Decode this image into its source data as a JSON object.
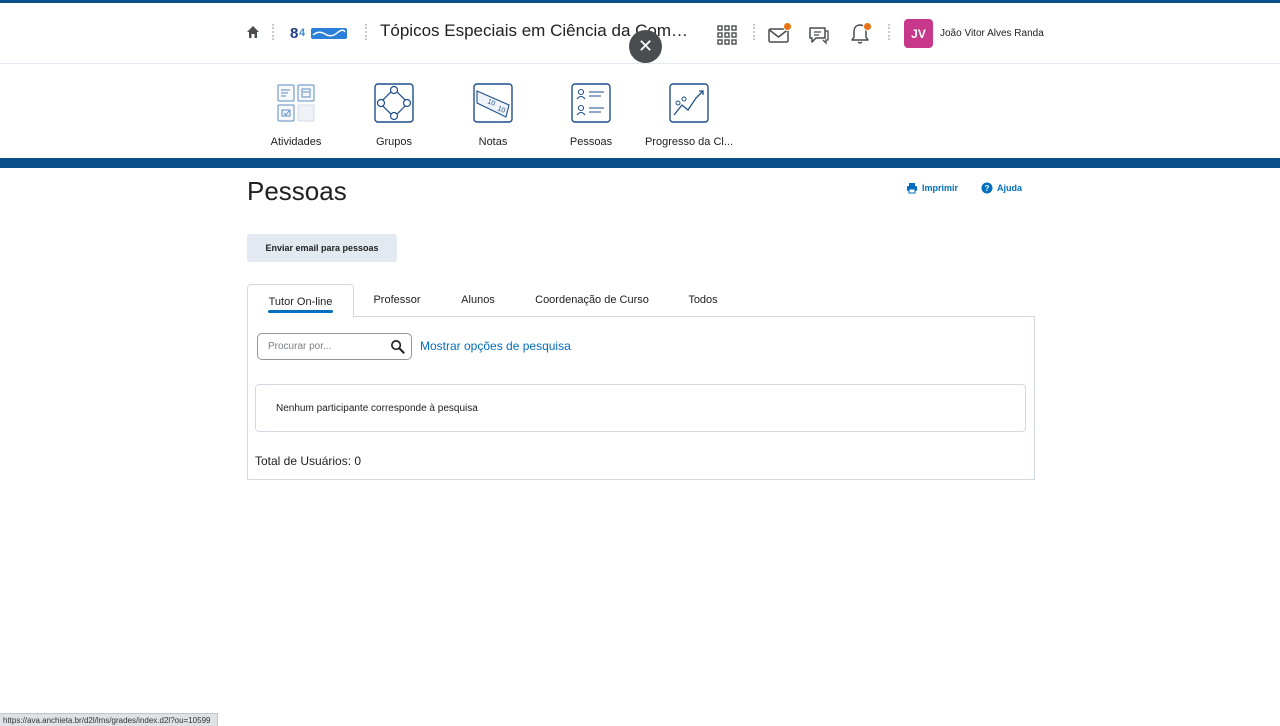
{
  "header": {
    "course_title": "Tópicos Especiais em Ciência da Compu...",
    "close_glyph": "✕",
    "user": {
      "initials": "JV",
      "name": "João Vitor Alves Randa",
      "avatar_color": "#c7388a"
    },
    "notification_color": "#e87511"
  },
  "nav": {
    "items": [
      {
        "label": "Atividades",
        "icon": "activities-icon"
      },
      {
        "label": "Grupos",
        "icon": "groups-icon"
      },
      {
        "label": "Notas",
        "icon": "grades-icon"
      },
      {
        "label": "Pessoas",
        "icon": "people-icon"
      },
      {
        "label": "Progresso da Cl...",
        "icon": "progress-icon"
      }
    ]
  },
  "page": {
    "title": "Pessoas",
    "print_label": "Imprimir",
    "help_label": "Ajuda",
    "email_button": "Enviar email para pessoas"
  },
  "tabs": [
    "Tutor On-line",
    "Professor",
    "Alunos",
    "Coordenação de Curso",
    "Todos"
  ],
  "active_tab": "Tutor On-line",
  "search": {
    "placeholder": "Procurar por...",
    "options_link": "Mostrar opções de pesquisa"
  },
  "results": {
    "empty_message": "Nenhum participante corresponde à pesquisa",
    "total_label": "Total de Usuários: 0"
  },
  "status_bar": {
    "url": "https://ava.anchieta.br/d2l/lms/grades/index.d2l?ou=10599"
  },
  "colors": {
    "brand_blue": "#0b4f8a",
    "link_blue": "#006fbf"
  }
}
